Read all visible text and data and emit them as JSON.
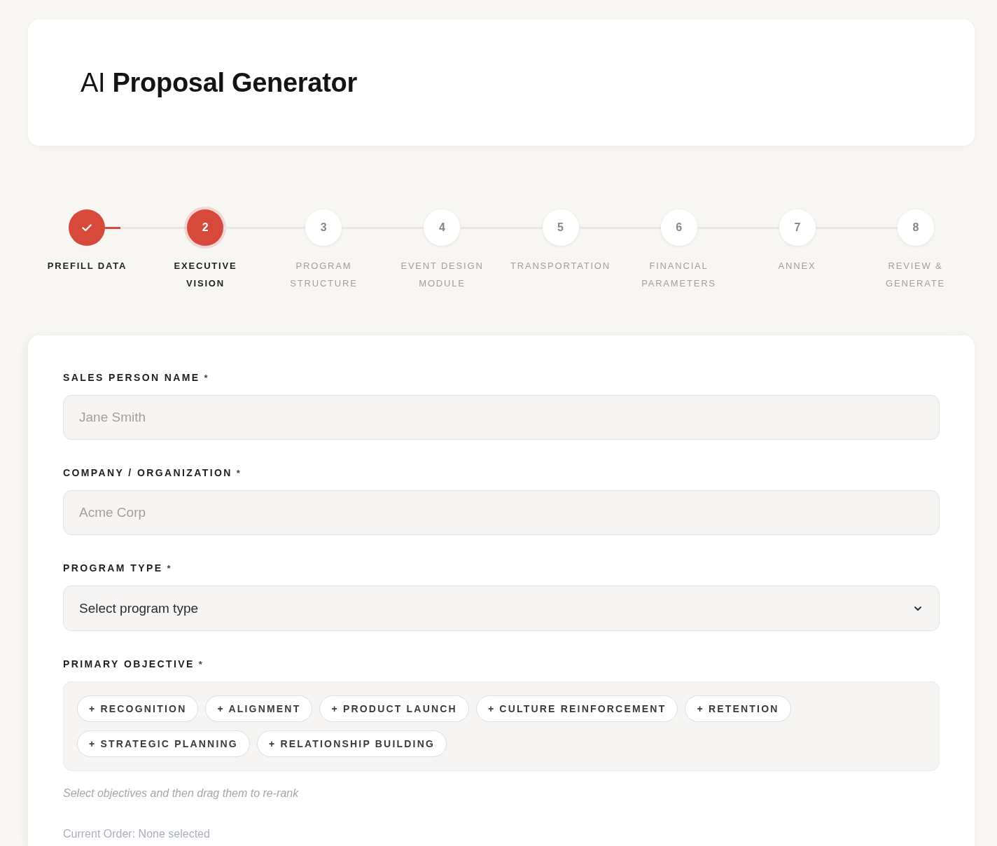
{
  "header": {
    "title": "AI **Proposal Generator**"
  },
  "steps": [
    {
      "label": "PREFILL DATA",
      "completed": true,
      "current": false
    },
    {
      "number": "2",
      "label": "EXECUTIVE VISION",
      "completed": false,
      "current": true
    },
    {
      "number": "3",
      "label": "PROGRAM STRUCTURE",
      "completed": false,
      "current": false
    },
    {
      "number": "4",
      "label": "EVENT DESIGN MODULE",
      "completed": false,
      "current": false
    },
    {
      "number": "5",
      "label": "TRANSPORTATION",
      "completed": false,
      "current": false
    },
    {
      "number": "6",
      "label": "FINANCIAL PARAMETERS",
      "completed": false,
      "current": false
    },
    {
      "number": "7",
      "label": "ANNEX",
      "completed": false,
      "current": false
    },
    {
      "number": "8",
      "label": "REVIEW & GENERATE",
      "completed": false,
      "current": false
    }
  ],
  "form": {
    "fields": [
      {
        "kind": "text",
        "label": "SALES PERSON NAME",
        "required_mark": "*",
        "placeholder": "Jane Smith"
      },
      {
        "kind": "text",
        "label": "COMPANY / ORGANIZATION",
        "required_mark": "*",
        "placeholder": "Acme Corp"
      },
      {
        "kind": "select",
        "label": "PROGRAM TYPE",
        "required_mark": "*",
        "placeholder": "Select program type"
      },
      {
        "kind": "chips",
        "label": "PRIMARY OBJECTIVE",
        "required_mark": "*",
        "options": [
          {
            "label": "+ RECOGNITION",
            "selected": false
          },
          {
            "label": "+ ALIGNMENT",
            "selected": false
          },
          {
            "label": "+ PRODUCT LAUNCH",
            "selected": false
          },
          {
            "label": "+ CULTURE REINFORCEMENT",
            "selected": false
          },
          {
            "label": "+ RETENTION",
            "selected": false
          },
          {
            "label": "+ STRATEGIC PLANNING",
            "selected": false
          },
          {
            "label": "+ RELATIONSHIP BUILDING",
            "selected": false
          }
        ],
        "hint": "Select objectives and then drag them to re-rank",
        "current_order": "Current Order: None selected"
      }
    ]
  }
}
